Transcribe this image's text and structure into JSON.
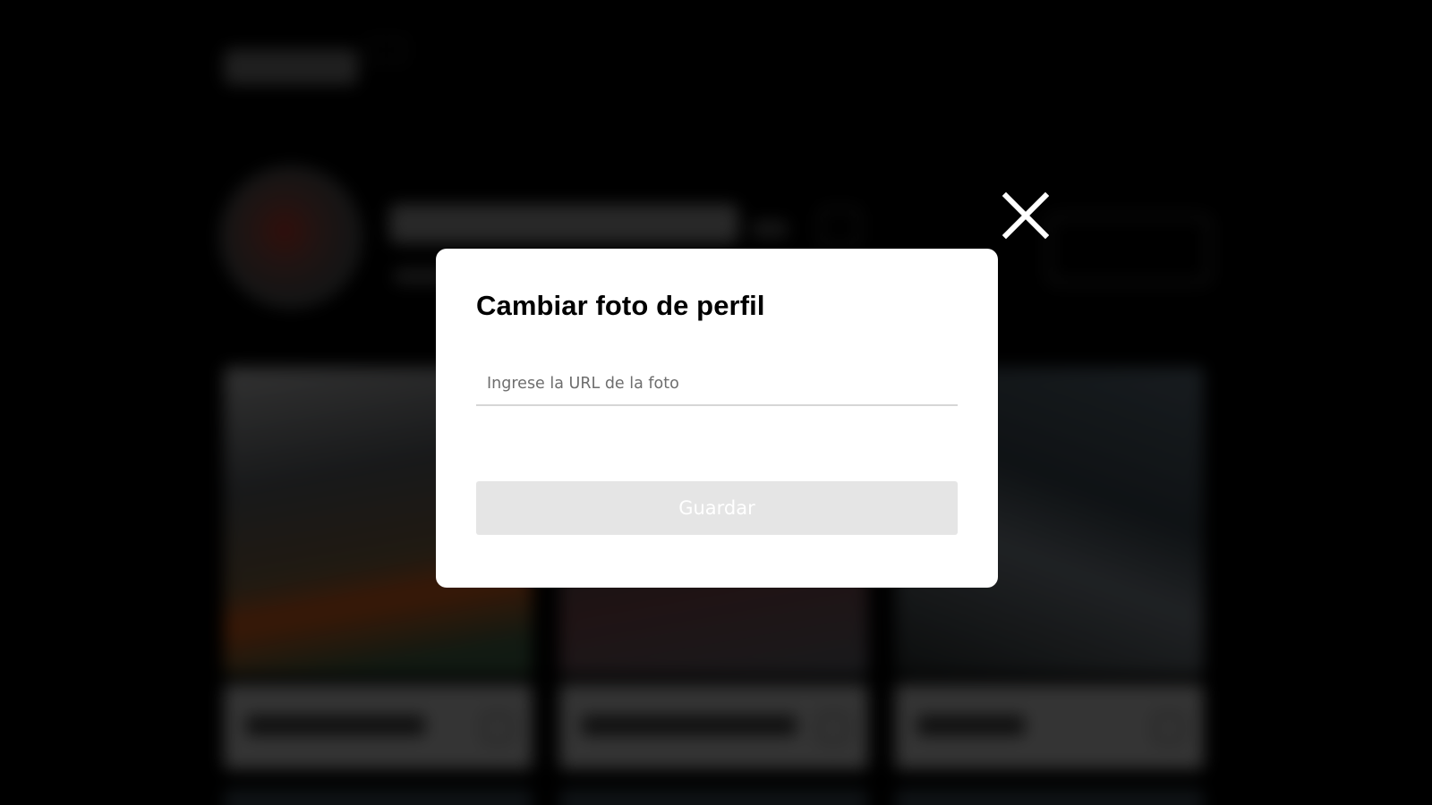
{
  "modal": {
    "title": "Cambiar foto de perfil",
    "url_input": {
      "value": "",
      "placeholder": "Ingrese la URL de la foto"
    },
    "save_label": "Guardar",
    "close_icon": "close-icon"
  },
  "colors": {
    "backdrop": "#000000",
    "modal_background": "#ffffff",
    "title_text": "#000000",
    "button_disabled_background": "#e5e5e5",
    "button_text": "#ffffff",
    "input_underline": "#d6d6d6",
    "placeholder_text": "#6e6e6e"
  }
}
